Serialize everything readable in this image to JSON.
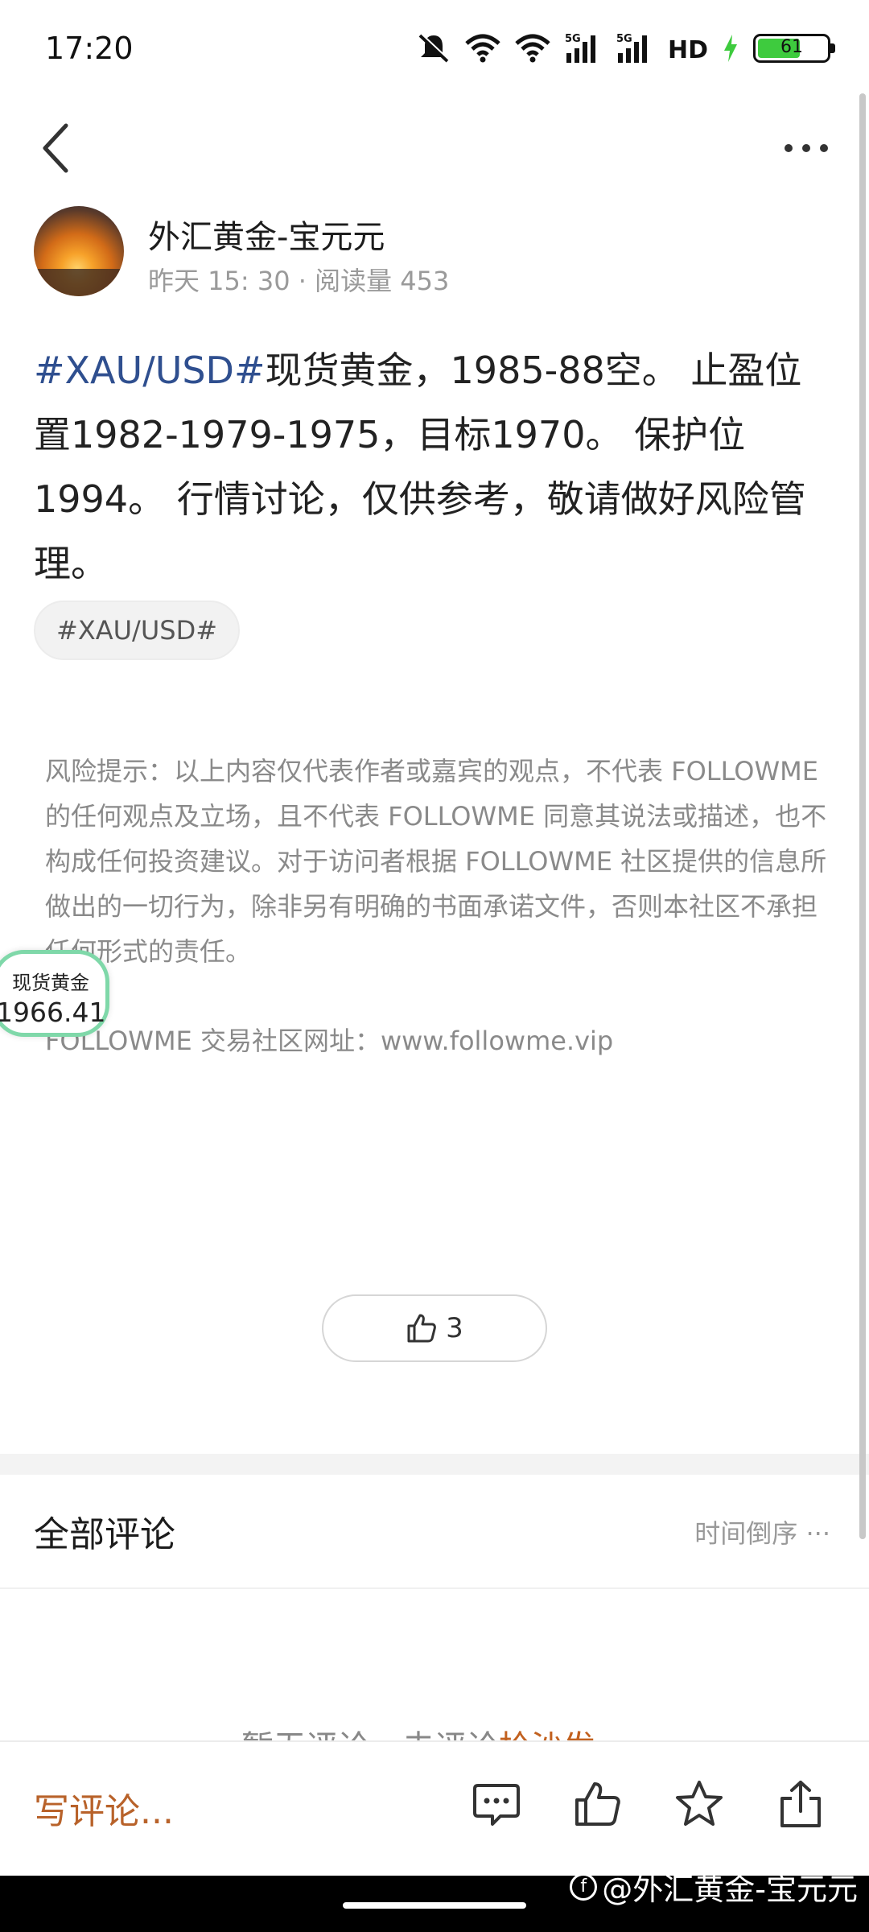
{
  "status_bar": {
    "time": "17:20",
    "battery": "61",
    "icons": [
      "mute-icon",
      "wifi-icon",
      "wifi-icon",
      "signal-5g-icon",
      "signal-5g-icon",
      "hd-icon",
      "charging-icon",
      "battery-icon"
    ]
  },
  "header": {
    "back_icon": "chevron-left-icon",
    "more_icon": "more-dots-icon"
  },
  "author": {
    "name": "外汇黄金-宝元元",
    "meta": "昨天 15: 30 · 阅读量 453"
  },
  "post": {
    "hashtag": "#XAU/USD#",
    "body": "现货黄金，1985-88空。 止盈位置1982-1979-1975，目标1970。 保护位1994。 行情讨论，仅供参考，敬请做好风险管理。",
    "tag_chip": "#XAU/USD#"
  },
  "disclaimer": {
    "risk_text": "风险提示：以上内容仅代表作者或嘉宾的观点，不代表 FOLLOWME 的任何观点及立场，且不代表 FOLLOWME 同意其说法或描述，也不构成任何投资建议。对于访问者根据 FOLLOWME 社区提供的信息所做出的一切行为，除非另有明确的书面承诺文件，否则本社区不承担任何形式的责任。",
    "site_text": "FOLLOWME 交易社区网址：www.followme.vip"
  },
  "price_widget": {
    "label": "现货黄金",
    "value": "1966.41"
  },
  "like": {
    "count": "3",
    "icon": "thumbs-up-icon"
  },
  "comments": {
    "title": "全部评论",
    "sort_label": "时间倒序 ···",
    "empty_prefix": "暂无评论，去评论",
    "empty_action": "抢沙发"
  },
  "bottom_bar": {
    "write_comment": "写评论...",
    "icons": [
      "comment-icon",
      "thumbs-up-icon",
      "star-icon",
      "share-icon"
    ]
  },
  "watermark": {
    "text": "@外汇黄金-宝元元",
    "logo": "f"
  },
  "colors": {
    "hashtag": "#2f4f8f",
    "accent": "#b8622a",
    "price_border": "#7fd8a9",
    "battery": "#3ecb3e"
  }
}
